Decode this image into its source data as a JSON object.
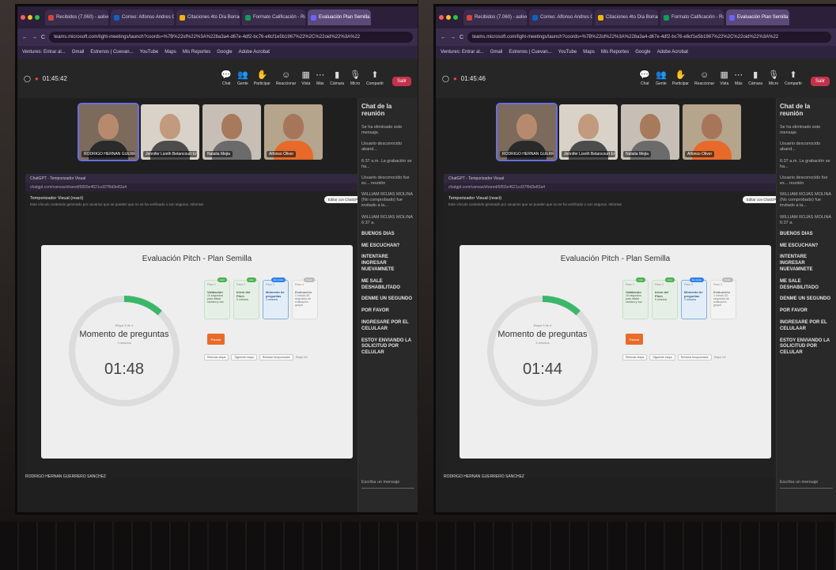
{
  "browser": {
    "tabs": [
      "Recibidos (7.060) - aoliver...",
      "Correo: Alfonso Andres Oliv...",
      "Citaciones 4to Día Borrador",
      "Formato Calificación - Rub...",
      "Evaluación Plan Semilla |..."
    ],
    "url": "teams.microsoft.com/light-meetings/launch?coords=%7B%22id%22%3A%228a3a4-d67e-4df2-bc76-e6cf1e5b1967%22%2C%22oid%22%3A%22",
    "bookmarks": [
      "Ventures: Entrar al...",
      "Gmail",
      "Estrenos | Cuevan...",
      "YouTube",
      "Maps",
      "Mis Reportes",
      "Google",
      "Adobe Acrobat"
    ]
  },
  "teams": {
    "tools": [
      {
        "icon": "chat-icon",
        "glyph": "💬",
        "label": "Chat"
      },
      {
        "icon": "people-icon",
        "glyph": "👥",
        "label": "Gente"
      },
      {
        "icon": "raise-hand-icon",
        "glyph": "✋",
        "label": "Participar"
      },
      {
        "icon": "react-icon",
        "glyph": "☺",
        "label": "Reaccionar"
      },
      {
        "icon": "view-icon",
        "glyph": "▦",
        "label": "Vista"
      },
      {
        "icon": "more-icon",
        "glyph": "⋯",
        "label": "Más"
      },
      {
        "icon": "camera-icon",
        "glyph": "▮",
        "label": "Cámara"
      },
      {
        "icon": "mic-icon",
        "glyph": "🎙",
        "label": "Micro"
      },
      {
        "icon": "share-icon",
        "glyph": "⬆",
        "label": "Compartir"
      }
    ],
    "participants": [
      {
        "name": "RODRIGO HERNAN GUERRERO...",
        "bg": "#7c6a5d",
        "skin": "#b88a6d",
        "shirt": "#2a2a2a"
      },
      {
        "name": "Jennifer Lizeth Betancourt En...",
        "bg": "#d8d2c8",
        "skin": "#c29a7e",
        "shirt": "#4c4c4c"
      },
      {
        "name": "Natalia Mejia",
        "bg": "#c7bfb5",
        "skin": "#a87a5c",
        "shirt": "#6b6b6b"
      },
      {
        "name": "Alfonso Oliver",
        "bg": "#b4a58c",
        "skin": "#a7765a",
        "shirt": "#e76a2a"
      }
    ],
    "chat": {
      "title": "Chat de la reunión",
      "deleted": "Se ha eliminado este mensaje.",
      "system": [
        "Usuario desconocido aband...",
        "6:37 a.m. La grabación se ha...",
        "Usuario desconocido fue ex... reunión",
        "WILLIAM ROJAS MOLINA (No comprobado) fue invitado a la..."
      ],
      "author": "WILLIAM ROJAS MOLINA 6:37 a.",
      "messages": [
        "BUENOS DIAS",
        "ME ESCUCHAN?",
        "INTENTARE INGRESAR NUEVAMNETE",
        "ME SALE DESHABILITADO",
        "DENME UN SEGUNDO",
        "POR FAVOR",
        "INGRESARE POR EL CELULAAR",
        "ESTOY ENVIANDO LA SOLICITUD POR CELULAR"
      ],
      "placeholder": "Escriba un mensaje"
    },
    "presenter": "RODRIGO HERNAN GUERRERO SANCHEZ"
  },
  "shared": {
    "tab_label": "ChatGPT - Temporizador Visual",
    "url": "chatgpt.com/canvas/shared/6855e4621cd37f9d3e82a4",
    "header": "Temporizador Visual (react)",
    "subheader": "Este vínculo contenido generado por usuarios que se pueden que no se ha verificado o son seguros. Informar",
    "open_btn": "Editar con ChatGPT",
    "title": "Evaluación Pitch - Plan Semilla",
    "stage_label": "Etapa 3 de 4",
    "phase": "Momento de preguntas",
    "phase_sub": "3 minutos",
    "progress": 0.12,
    "steps": [
      {
        "n": "Paso 1",
        "badge": "Listo",
        "title": "Validación",
        "desc": "10 segundos para alistar cámara y voz",
        "state": "done"
      },
      {
        "n": "Paso 2",
        "badge": "Listo",
        "title": "Inicio del Pitch",
        "desc": "5 minutos",
        "state": "done"
      },
      {
        "n": "Paso 3",
        "badge": "En curso",
        "title": "Momento de preguntas",
        "desc": "3 minutos",
        "state": "cur"
      },
      {
        "n": "Paso 4",
        "badge": "Pend.",
        "title": "Evaluación",
        "desc": "1 minuto 30 segundos de evaluación grupal",
        "state": "pend"
      }
    ],
    "pause_btn": "Pausar",
    "controls": [
      "Reiniciar etapa",
      "Siguiente etapa",
      "Reiniciar temporizador"
    ],
    "hint": "Etapa 3/4"
  },
  "left_shot": {
    "meeting_time": "01:45:42",
    "countdown": "01:48"
  },
  "right_shot": {
    "meeting_time": "01:45:46",
    "countdown": "01:44"
  }
}
